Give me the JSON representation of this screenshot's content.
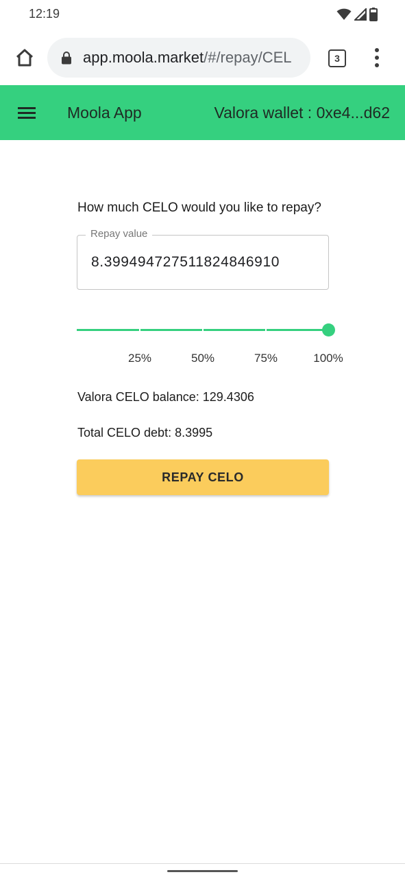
{
  "status_bar": {
    "time": "12:19"
  },
  "browser": {
    "url_domain": "app.moola.market",
    "url_path": "/#/repay/CEL",
    "tab_count": "3"
  },
  "header": {
    "title": "Moola App",
    "wallet": "Valora wallet : 0xe4...d62",
    "background_color": "#35d07f"
  },
  "repay": {
    "question": "How much CELO would you like to repay?",
    "field_label": "Repay value",
    "field_value": "8.399494727511824846910",
    "slider": {
      "value_percent": 100,
      "labels": [
        "25%",
        "50%",
        "75%",
        "100%"
      ]
    },
    "balance_text": "Valora CELO balance: 129.4306",
    "debt_text": "Total CELO debt: 8.3995",
    "button_label": "REPAY CELO",
    "button_color": "#fbcc5c"
  }
}
